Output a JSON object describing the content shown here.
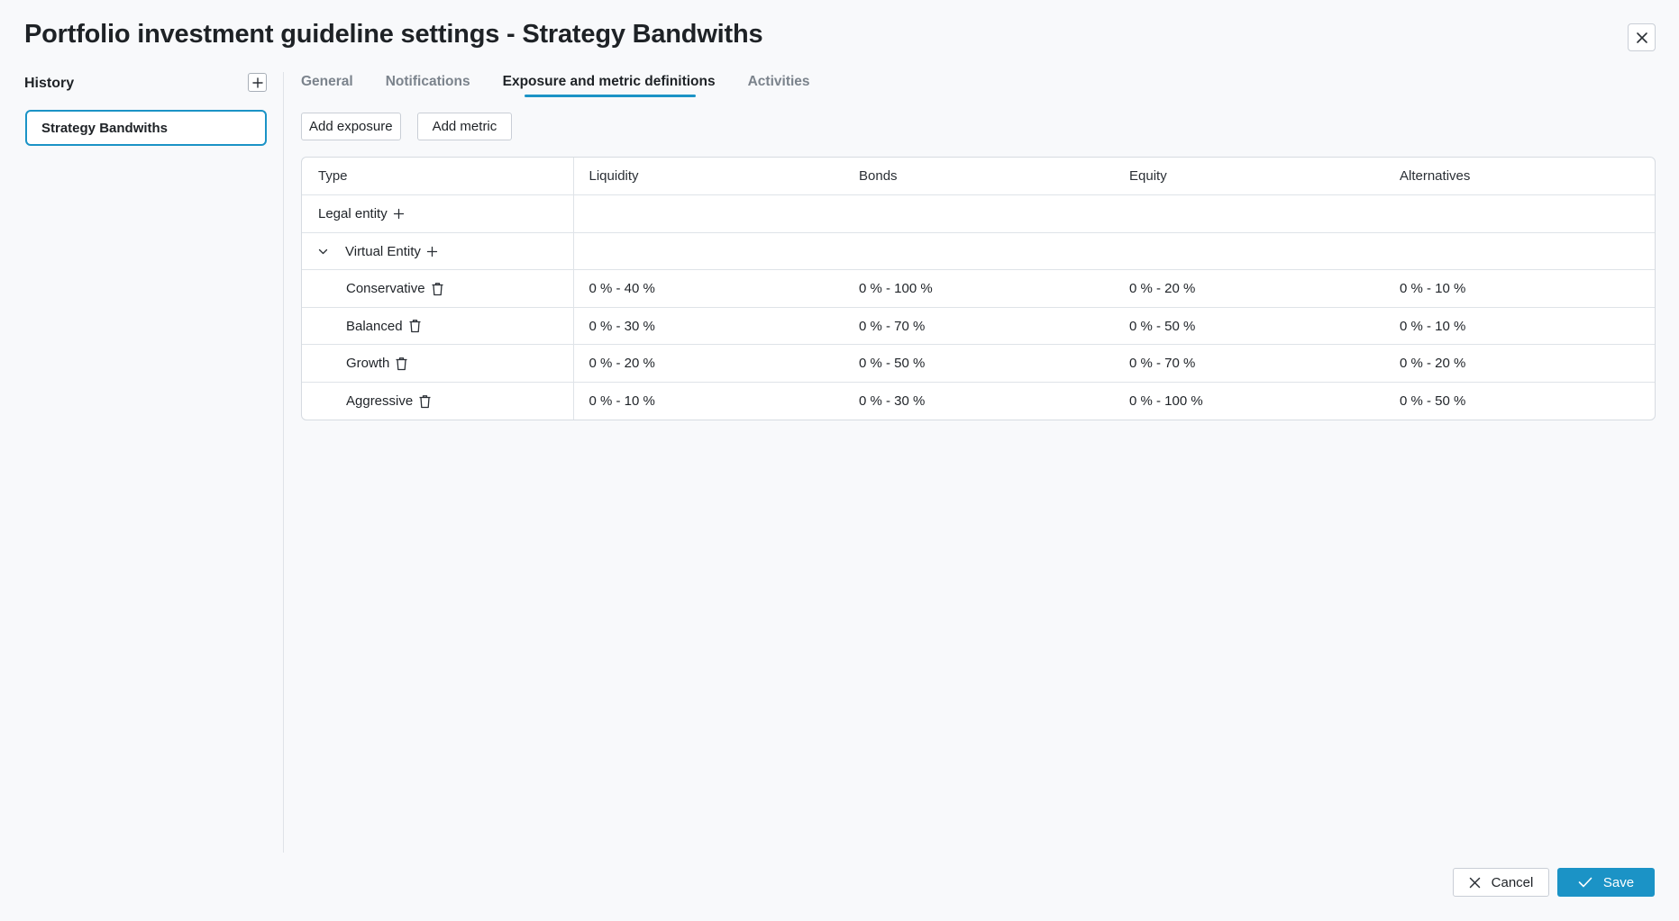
{
  "title": "Portfolio investment guideline settings - Strategy Bandwiths",
  "icons": {
    "close": "close-icon",
    "add": "plus-icon",
    "delete": "trash-icon",
    "expand": "chevron-down-icon",
    "confirm": "check-icon"
  },
  "colors": {
    "accent": "#1b93c6",
    "background": "#f8f9fb"
  },
  "sidebar": {
    "label": "History",
    "items": [
      {
        "label": "Strategy Bandwiths",
        "selected": true
      }
    ]
  },
  "tabs": [
    {
      "label": "General",
      "active": false
    },
    {
      "label": "Notifications",
      "active": false
    },
    {
      "label": "Exposure and metric definitions",
      "active": true
    },
    {
      "label": "Activities",
      "active": false
    }
  ],
  "actions": {
    "add_exposure": "Add exposure",
    "add_metric": "Add metric"
  },
  "table": {
    "headers": [
      "Type",
      "Liquidity",
      "Bonds",
      "Equity",
      "Alternatives"
    ],
    "groups": {
      "legal_entity": "Legal entity",
      "virtual_entity": "Virtual Entity"
    },
    "rows": [
      {
        "name": "Conservative",
        "values": [
          "0 % - 40 %",
          "0 % - 100 %",
          "0 % - 20 %",
          "0 % - 10 %"
        ]
      },
      {
        "name": "Balanced",
        "values": [
          "0 % - 30 %",
          "0 % - 70 %",
          "0 % - 50 %",
          "0 % - 10 %"
        ]
      },
      {
        "name": "Growth",
        "values": [
          "0 % - 20 %",
          "0 % - 50 %",
          "0 % - 70 %",
          "0 % - 20 %"
        ]
      },
      {
        "name": "Aggressive",
        "values": [
          "0 % - 10 %",
          "0 % - 30 %",
          "0 % - 100 %",
          "0 % - 50 %"
        ]
      }
    ]
  },
  "footer": {
    "cancel": "Cancel",
    "save": "Save"
  }
}
